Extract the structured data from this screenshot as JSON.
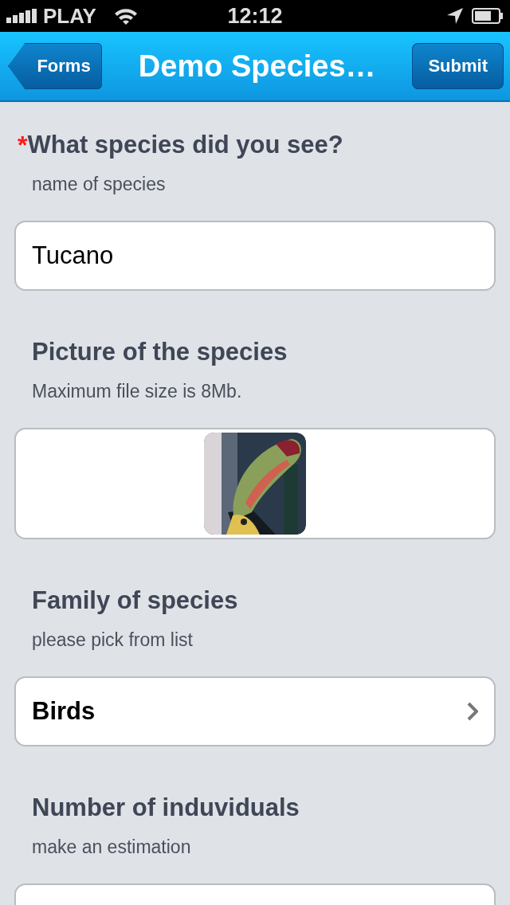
{
  "status_bar": {
    "carrier": "PLAY",
    "time": "12:12"
  },
  "nav": {
    "back": "Forms",
    "title": "Demo Species…",
    "action": "Submit"
  },
  "fields": [
    {
      "kind": "text",
      "required_mark": "*",
      "label": "What species did you see?",
      "hint": "name of species",
      "value": "Tucano"
    },
    {
      "label": "Picture of the species",
      "hint": "Maximum file size is 8Mb."
    },
    {
      "kind": "select",
      "label": "Family of species",
      "hint": "please pick from list",
      "value": "Birds"
    },
    {
      "kind": "text",
      "label": "Number of induviduals",
      "hint": "make an estimation"
    }
  ]
}
